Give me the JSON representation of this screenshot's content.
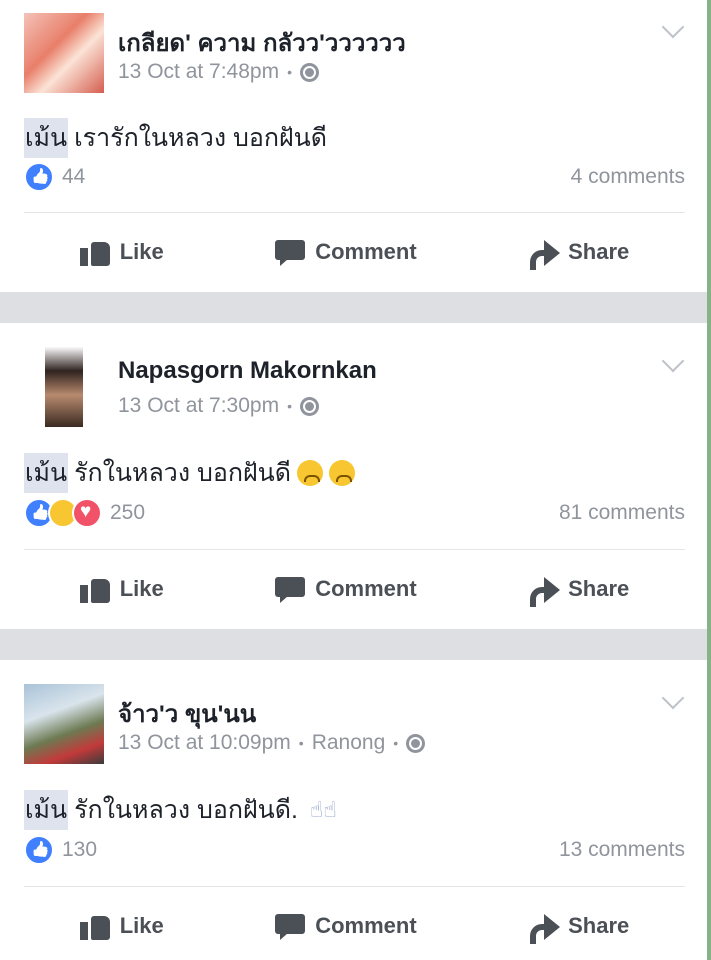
{
  "posts": [
    {
      "author": "เกลียด' ความ กลัวว'วววววว",
      "timestamp": "13 Oct at 7:48pm",
      "location": "",
      "tag": "เม้น",
      "text": "เรารักในหลวง บอกฝันดี",
      "reaction_count": "44",
      "comments": "4 comments",
      "actions": {
        "like": "Like",
        "comment": "Comment",
        "share": "Share"
      }
    },
    {
      "author": "Napasgorn Makornkan",
      "timestamp": "13 Oct at 7:30pm",
      "location": "",
      "tag": "เม้น",
      "text": "รักในหลวง บอกฝันดี",
      "reaction_count": "250",
      "comments": "81 comments",
      "actions": {
        "like": "Like",
        "comment": "Comment",
        "share": "Share"
      }
    },
    {
      "author": "จ้าว'ว ขุน'นน",
      "timestamp": "13 Oct at 10:09pm",
      "location": "Ranong",
      "tag": "เม้น",
      "text": "รักในหลวง  บอกฝันดี.",
      "reaction_count": "130",
      "comments": "13 comments",
      "actions": {
        "like": "Like",
        "comment": "Comment",
        "share": "Share"
      }
    }
  ],
  "icons": {
    "privacy": "globe-icon",
    "menu": "chevron-down-icon",
    "like": "thumbs-up-icon",
    "comment": "speech-bubble-icon",
    "share": "share-arrow-icon"
  },
  "colors": {
    "like_blue": "#4080ff",
    "love_red": "#f25268",
    "sad_yellow": "#f7c631",
    "meta_gray": "#90949c",
    "separator": "#dddfe2"
  }
}
